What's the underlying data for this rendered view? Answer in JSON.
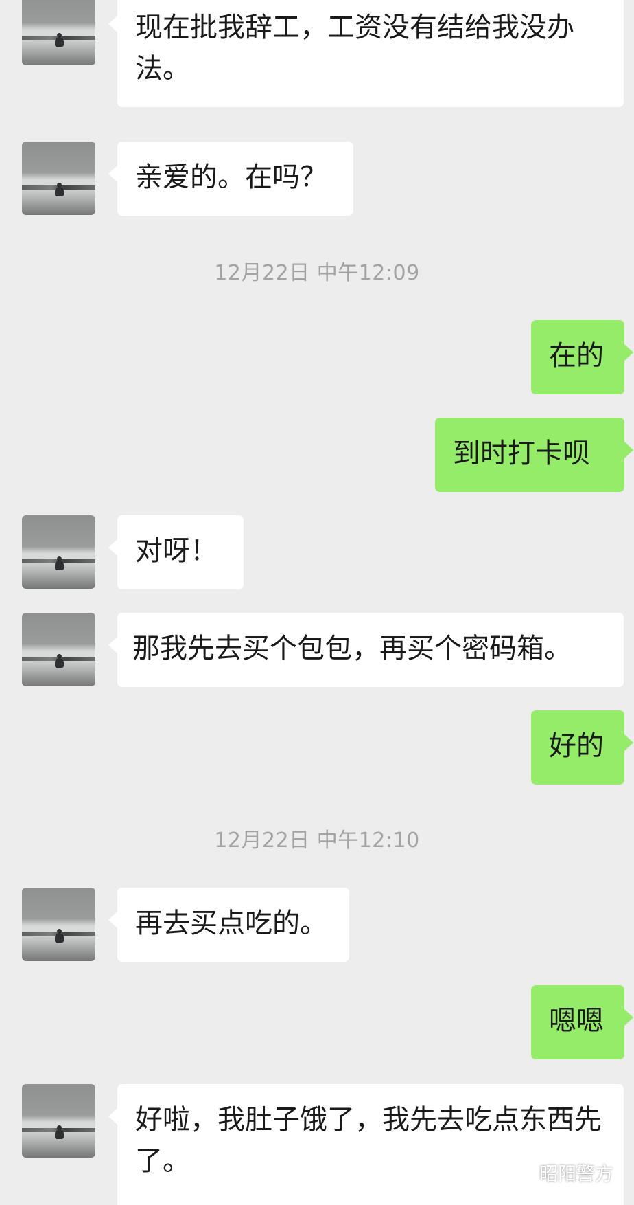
{
  "messages": [
    {
      "side": "in",
      "text": "现在批我辞工，工资没有结给我没办法。"
    },
    {
      "side": "in",
      "text": "亲爱的。在吗？"
    },
    {
      "side": "out",
      "text": "在的"
    },
    {
      "side": "out",
      "text": "到时打卡呗"
    },
    {
      "side": "in",
      "text": "对呀！"
    },
    {
      "side": "in",
      "text": "那我先去买个包包，再买个密码箱。"
    },
    {
      "side": "out",
      "text": "好的"
    },
    {
      "side": "in",
      "text": "再去买点吃的。"
    },
    {
      "side": "out",
      "text": "嗯嗯"
    },
    {
      "side": "in",
      "text": "好啦，我肚子饿了，我先去吃点东西先了。"
    }
  ],
  "timestamps": [
    "12月22日 中午12:09",
    "12月22日 中午12:10"
  ],
  "watermark": {
    "text": "昭阳警方",
    "icon": "wechat-official-account-icon"
  },
  "colors": {
    "background": "#ededed",
    "incoming_bubble": "#ffffff",
    "outgoing_bubble": "#95ec69",
    "timestamp_text": "#a3a3a3"
  }
}
